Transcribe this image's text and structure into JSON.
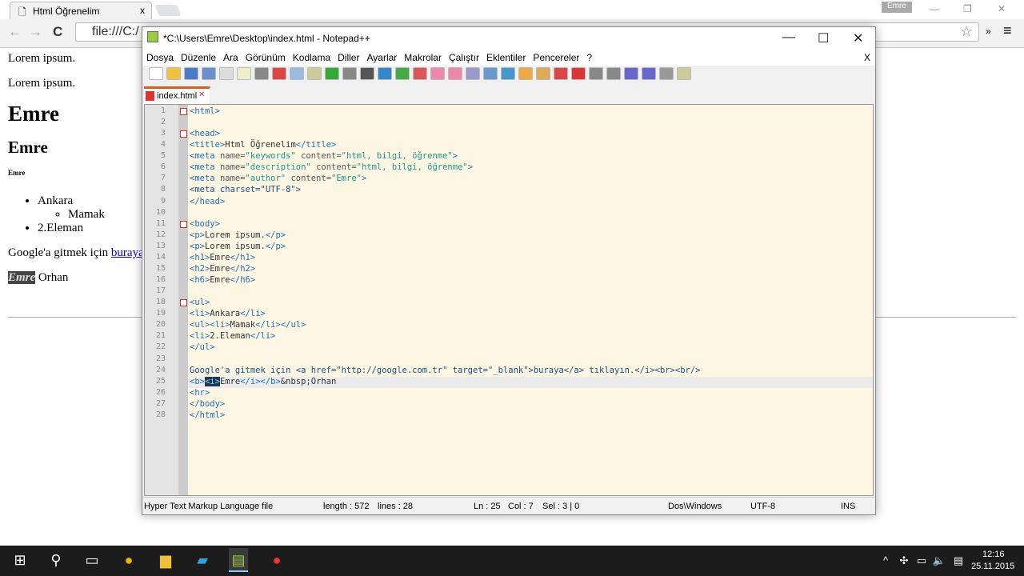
{
  "browser": {
    "tab_title": "Html Öğrenelim",
    "tab_close": "x",
    "address": "file:///C:/",
    "user_badge": "Emre",
    "back": "←",
    "forward": "→",
    "reload": "C",
    "star": "☆",
    "more": "»",
    "menu": "≡",
    "min": "—",
    "restore": "❐",
    "close": "✕"
  },
  "page": {
    "p1": "Lorem ipsum.",
    "p2": "Lorem ipsum.",
    "h1": "Emre",
    "h2": "Emre",
    "h6": "Emre",
    "list": [
      "Ankara",
      "2.Eleman"
    ],
    "sublist": [
      "Mamak"
    ],
    "link_prefix": "Google'a gitmek için ",
    "link_text": "buraya",
    "bold_italic": "Emre",
    "after": " Orhan"
  },
  "npp": {
    "title": "*C:\\Users\\Emre\\Desktop\\index.html - Notepad++",
    "min": "—",
    "max": "☐",
    "close": "✕",
    "menu_close": "X",
    "menu": [
      "Dosya",
      "Düzenle",
      "Ara",
      "Görünüm",
      "Kodlama",
      "Diller",
      "Ayarlar",
      "Makrolar",
      "Çalıştır",
      "Eklentiler",
      "Pencereler",
      "?"
    ],
    "file_tab": "index.html",
    "file_tab_close": "✕",
    "lines": [
      "<html>",
      "",
      "<head>",
      "<title>Html Öğrenelim</title>",
      "<meta name=\"keywords\" content=\"html, bilgi, öğrenme\">",
      "<meta name=\"description\" content=\"html, bilgi, öğrenme\">",
      "<meta name=\"author\" content=\"Emre\">",
      "<meta charset=\"UTF-8\">",
      "</head>",
      "",
      "<body>",
      "<p>Lorem ipsum.</p>",
      "<p>Lorem ipsum.</p>",
      "<h1>Emre</h1>",
      "<h2>Emre</h2>",
      "<h6>Emre</h6>",
      "",
      "<ul>",
      "<li>Ankara</li>",
      "<ul><li>Mamak</li></ul>",
      "<li>2.Eleman</li>",
      "</ul>",
      "",
      "Google'a gitmek için <a href=\"http://google.com.tr\" target=\"_blank\">buraya</a> tıklayın.</i><br><br/>",
      "<b><i>Emre</i></b>&nbsp;Orhan",
      "<hr>",
      "</body>",
      "</html>"
    ],
    "current_line": 25,
    "status": {
      "lang": "Hyper Text Markup Language file",
      "length": "length : 572",
      "lines": "lines : 28",
      "ln": "Ln : 25",
      "col": "Col : 7",
      "sel": "Sel : 3 | 0",
      "eol": "Dos\\Windows",
      "enc": "UTF-8",
      "mode": "INS"
    }
  },
  "taskbar": {
    "time": "12:16",
    "date": "25.11.2015"
  }
}
